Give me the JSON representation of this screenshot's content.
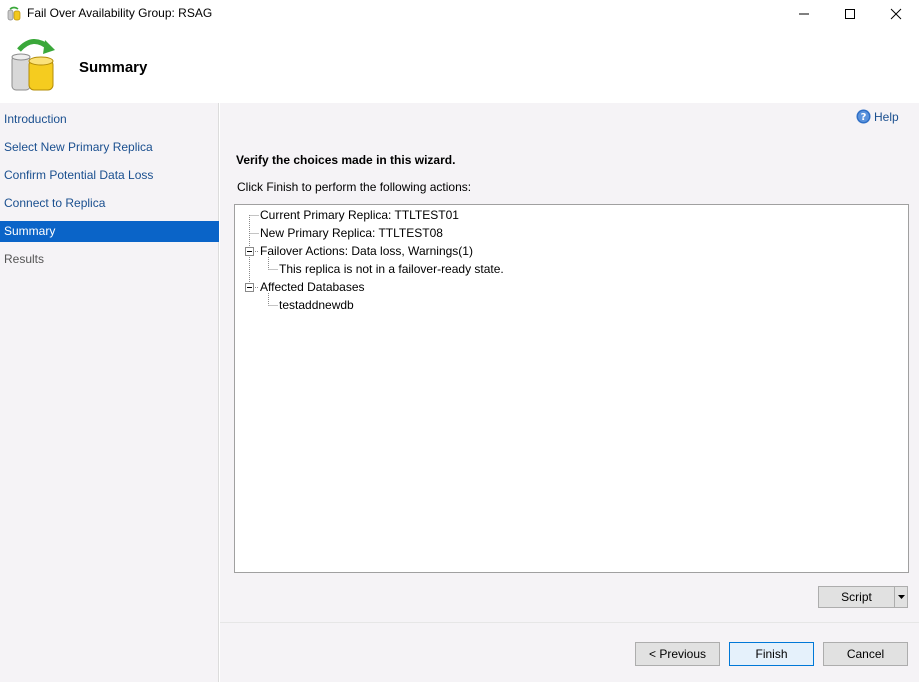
{
  "window": {
    "title": "Fail Over Availability Group: RSAG"
  },
  "header": {
    "title": "Summary"
  },
  "sidebar": {
    "items": [
      {
        "label": "Introduction",
        "state": "link"
      },
      {
        "label": "Select New Primary Replica",
        "state": "link"
      },
      {
        "label": "Confirm Potential Data Loss",
        "state": "link"
      },
      {
        "label": "Connect to Replica",
        "state": "link"
      },
      {
        "label": "Summary",
        "state": "active"
      },
      {
        "label": "Results",
        "state": "disabled"
      }
    ]
  },
  "main": {
    "help_label": "Help",
    "verify_text": "Verify the choices made in this wizard.",
    "instruction_text": "Click Finish to perform the following actions:",
    "tree": {
      "current_primary": "Current Primary Replica: TTLTEST01",
      "new_primary": "New Primary Replica: TTLTEST08",
      "failover_actions": "Failover Actions: Data loss, Warnings(1)",
      "failover_warning": "This replica is not in a failover-ready state.",
      "affected_databases": "Affected Databases",
      "database_1": "testaddnewdb"
    },
    "script_label": "Script"
  },
  "footer": {
    "previous_label": "< Previous",
    "finish_label": "Finish",
    "cancel_label": "Cancel"
  },
  "colors": {
    "accent": "#0a64c8",
    "link": "#1a4f8f",
    "panel_bg": "#f5f3f6"
  }
}
